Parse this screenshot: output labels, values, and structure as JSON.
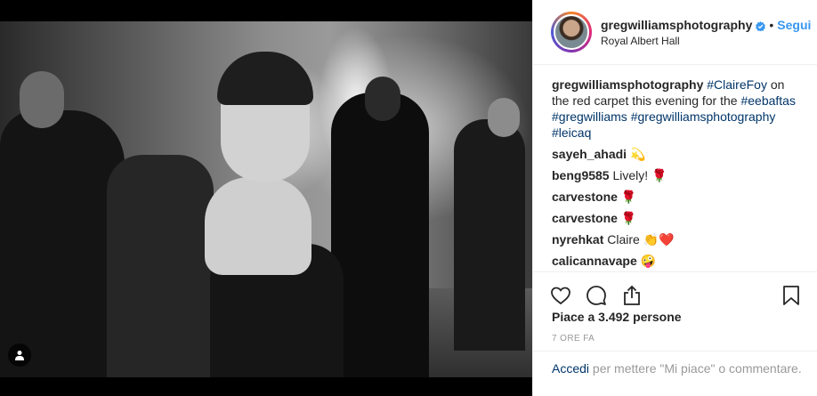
{
  "post": {
    "user_tag_icon": "person-icon"
  },
  "header": {
    "username": "gregwilliamsphotography",
    "separator": "•",
    "follow_label": "Segui",
    "location": "Royal Albert Hall",
    "verified_icon": "verified-badge-icon"
  },
  "caption": {
    "username": "gregwilliamsphotography",
    "tag1": "#ClaireFoy",
    "text1": " on the red carpet this evening for the ",
    "tag2": "#eebaftas",
    "tag3": "#gregwilliams",
    "tag4": "#gregwilliamsphotography",
    "tag5": "#leicaq"
  },
  "comments": [
    {
      "username": "sayeh_ahadi",
      "text": " 💫"
    },
    {
      "username": "beng9585",
      "text": " Lively! 🌹"
    },
    {
      "username": "carvestone",
      "text": " 🌹"
    },
    {
      "username": "carvestone",
      "text": " 🌹"
    },
    {
      "username": "nyrehkat",
      "text": " Claire 👏❤️"
    },
    {
      "username": "calicannavape",
      "text": " 🤪"
    }
  ],
  "actions": {
    "like_icon": "heart-icon",
    "comment_icon": "comment-icon",
    "share_icon": "share-icon",
    "save_icon": "bookmark-icon"
  },
  "likes_text": "Piace a 3.492 persone",
  "time_text": "7 ORE FA",
  "login": {
    "link": "Accedi",
    "rest": " per mettere \"Mi piace\" o commentare."
  },
  "colors": {
    "link_blue": "#3897f0",
    "hashtag": "#003569",
    "muted": "#999999"
  }
}
